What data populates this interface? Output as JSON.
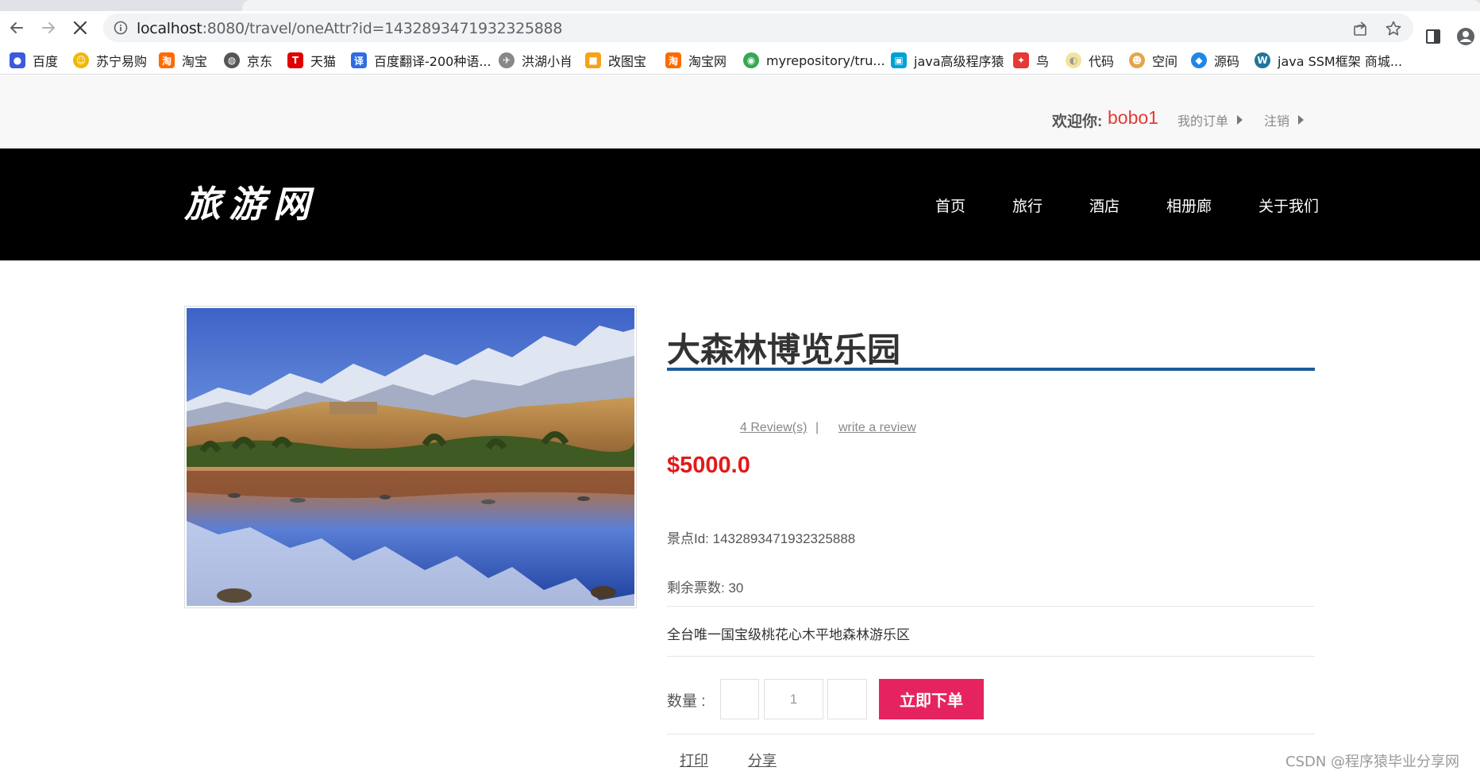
{
  "browser": {
    "url_host": "localhost",
    "url_path": ":8080/travel/oneAttr?id=1432893471932325888",
    "bookmarks": [
      {
        "label": "百度",
        "color": "#3b5bdb"
      },
      {
        "label": "苏宁易购",
        "color": "#f2b705"
      },
      {
        "label": "淘宝",
        "color": "#ff6a00"
      },
      {
        "label": "京东",
        "color": "#555555"
      },
      {
        "label": "天猫",
        "color": "#e00000"
      },
      {
        "label": "百度翻译-200种语...",
        "color": "#2f6de1"
      },
      {
        "label": "洪湖小肖",
        "color": "#888888"
      },
      {
        "label": "改图宝",
        "color": "#f7a21b"
      },
      {
        "label": "淘宝网",
        "color": "#ff6a00"
      },
      {
        "label": "myrepository/tru...",
        "color": "#34a853"
      },
      {
        "label": "java高级程序猿",
        "color": "#00a1d6"
      },
      {
        "label": "鸟",
        "color": "#e53935"
      },
      {
        "label": "代码",
        "color": "#f2e39c"
      },
      {
        "label": "空间",
        "color": "#e3a64a"
      },
      {
        "label": "源码",
        "color": "#1e88e5"
      },
      {
        "label": "java SSM框架 商城...",
        "color": "#21759b"
      }
    ]
  },
  "topbar": {
    "welcome_label": "欢迎你:",
    "username": "bobo1",
    "my_orders": "我的订单",
    "logout": "注销"
  },
  "header": {
    "logo": "旅游网",
    "nav": [
      "首页",
      "旅行",
      "酒店",
      "相册廊",
      "关于我们"
    ]
  },
  "product": {
    "title": "大森林博览乐园",
    "reviews": "4 Review(s)",
    "separator": "|",
    "write_review": "write a review",
    "price": "$5000.0",
    "attr_id": "景点Id: 1432893471932325888",
    "tickets": "剩余票数: 30",
    "description": "全台唯一国宝级桃花心木平地森林游乐区",
    "qty_label": "数量 :",
    "qty_value": "1",
    "order_button": "立即下单",
    "print": "打印",
    "share": "分享"
  },
  "watermark": "CSDN @程序猿毕业分享网",
  "colors": {
    "accent_rule": "#1b5e9a",
    "price": "#e01b1b",
    "order_button": "#e5245f",
    "username": "#e53935"
  }
}
